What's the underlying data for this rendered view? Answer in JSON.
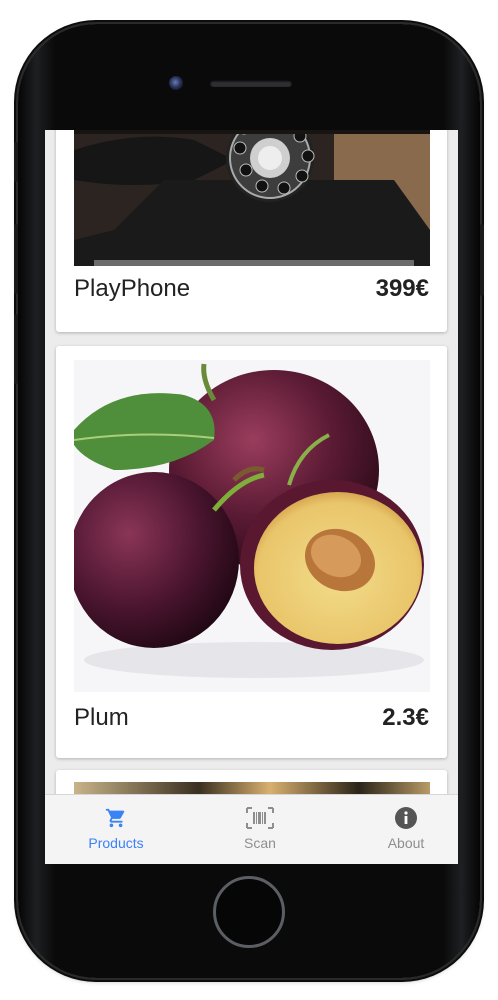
{
  "products": [
    {
      "name": "PlayPhone",
      "price": "399€"
    },
    {
      "name": "Plum",
      "price": "2.3€"
    }
  ],
  "tabs": [
    {
      "label": "Products",
      "icon": "cart-icon",
      "active": true
    },
    {
      "label": "Scan",
      "icon": "barcode-icon",
      "active": false
    },
    {
      "label": "About",
      "icon": "info-icon",
      "active": false
    }
  ],
  "colors": {
    "accent": "#3b82f6",
    "inactive": "#8e8e8e"
  }
}
